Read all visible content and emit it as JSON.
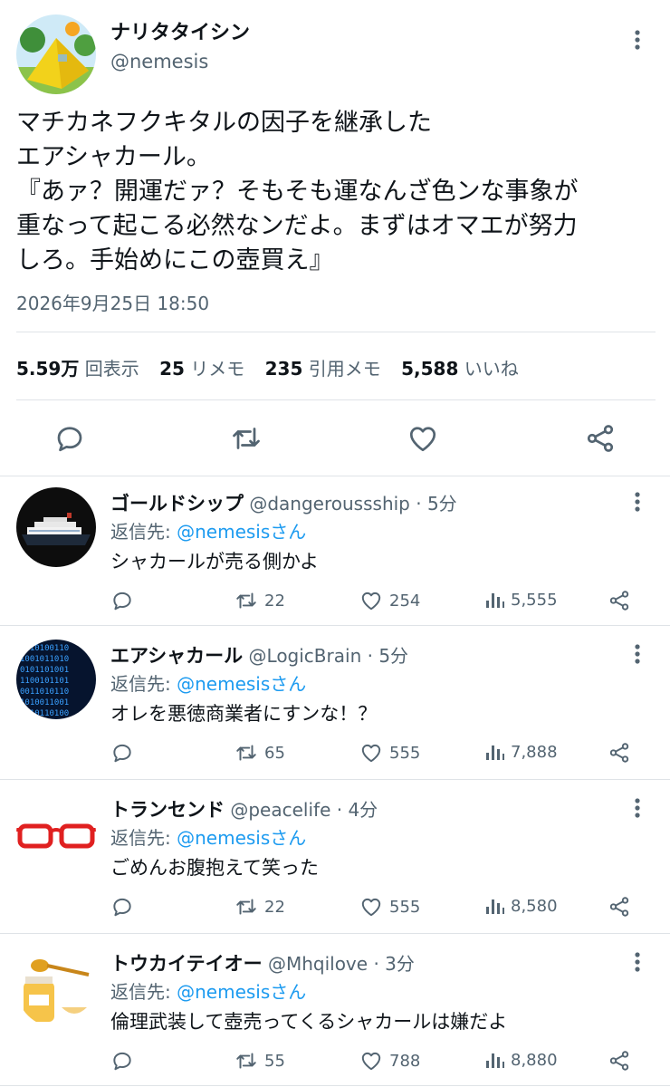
{
  "main_tweet": {
    "display_name": "ナリタタイシン",
    "handle": "@nemesis",
    "text_lines": [
      "マチカネフクキタルの因子を継承した",
      "エアシャカール。",
      "『あァ？開運だァ？そもそも運なんざ色ンな事象が",
      "重なって起こる必然なンだよ。まずはオマエが努力",
      "しろ。手始めにこの壺買え』"
    ],
    "timestamp": "2026年9月25日 18:50",
    "stats": {
      "views_count": "5.59万",
      "views_label": "回表示",
      "retweets_count": "25",
      "retweets_label": "リメモ",
      "quotes_count": "235",
      "quotes_label": "引用メモ",
      "likes_count": "5,588",
      "likes_label": "いいね"
    }
  },
  "replies": [
    {
      "display_name": "ゴールドシップ",
      "handle": "@dangeroussship",
      "separator": "·",
      "time": "5分",
      "reply_prefix": "返信先: ",
      "reply_to": "@nemesisさん",
      "text": "シャカールが売る側かよ",
      "retweets": "22",
      "likes": "254",
      "views": "5,555",
      "avatar": "cruise-ship"
    },
    {
      "display_name": "エアシャカール",
      "handle": "@LogicBrain",
      "separator": "·",
      "time": "5分",
      "reply_prefix": "返信先: ",
      "reply_to": "@nemesisさん",
      "text": "オレを悪徳商業者にすンな！？",
      "retweets": "65",
      "likes": "555",
      "views": "7,888",
      "avatar": "binary-code"
    },
    {
      "display_name": "トランセンド",
      "handle": "@peacelife",
      "separator": "·",
      "time": "4分",
      "reply_prefix": "返信先: ",
      "reply_to": "@nemesisさん",
      "text": "ごめんお腹抱えて笑った",
      "retweets": "22",
      "likes": "555",
      "views": "8,580",
      "avatar": "red-glasses"
    },
    {
      "display_name": "トウカイテイオー",
      "handle": "@Mhqilove",
      "separator": "·",
      "time": "3分",
      "reply_prefix": "返信先: ",
      "reply_to": "@nemesisさん",
      "text": "倫理武装して壺売ってくるシャカールは嫌だよ",
      "retweets": "55",
      "likes": "788",
      "views": "8,880",
      "avatar": "honey-jar"
    }
  ],
  "colors": {
    "text": "#0f1419",
    "muted": "#536471",
    "link": "#1d9bf0",
    "divider": "#dfe3e7"
  },
  "icons": [
    "more-icon",
    "reply-icon",
    "retweet-icon",
    "like-icon",
    "share-icon",
    "views-icon"
  ]
}
